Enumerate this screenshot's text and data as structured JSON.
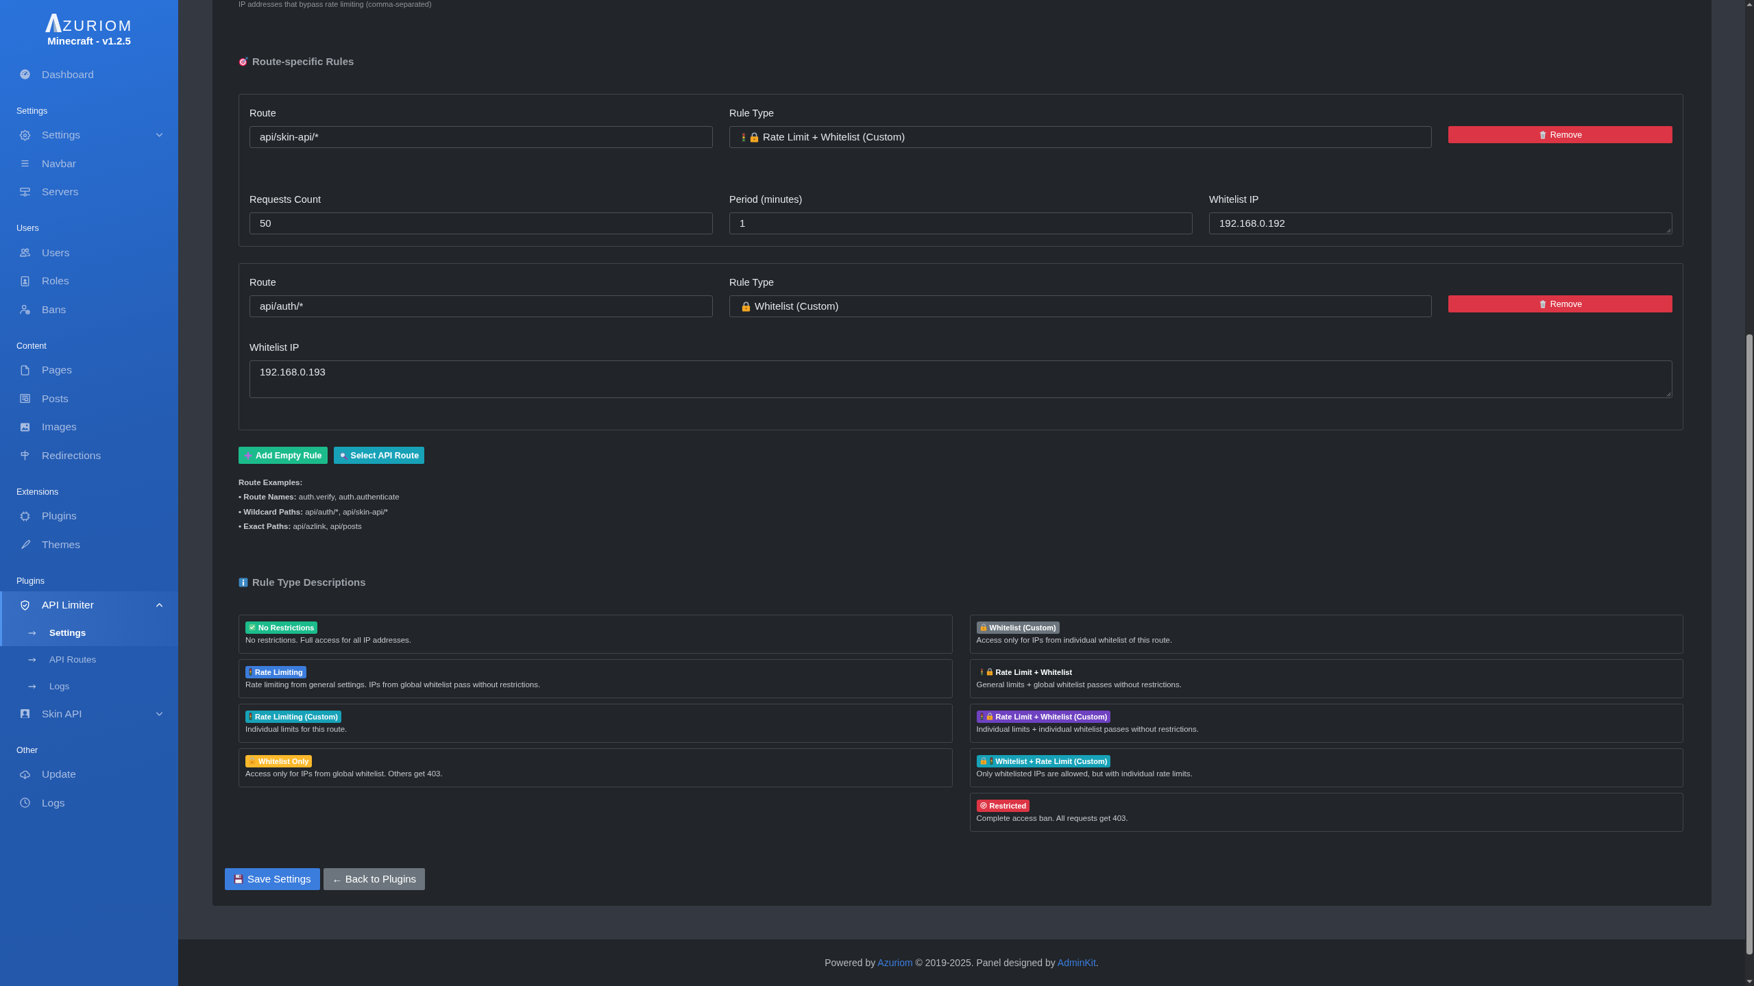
{
  "sidebar": {
    "logo_text": "ZURIOM",
    "subtitle": "Minecraft - v1.2.5",
    "sections": [
      {
        "items": [
          {
            "label": "Dashboard",
            "selected": false
          }
        ]
      },
      {
        "header": "Settings",
        "items": [
          {
            "label": "Settings",
            "selected": false,
            "expanded": false
          },
          {
            "label": "Navbar",
            "selected": false
          },
          {
            "label": "Servers",
            "selected": false
          }
        ]
      },
      {
        "header": "Users",
        "items": [
          {
            "label": "Users",
            "selected": false
          },
          {
            "label": "Roles",
            "selected": false
          },
          {
            "label": "Bans",
            "selected": false
          }
        ]
      },
      {
        "header": "Content",
        "items": [
          {
            "label": "Pages",
            "selected": false
          },
          {
            "label": "Posts",
            "selected": false
          },
          {
            "label": "Images",
            "selected": false
          },
          {
            "label": "Redirections",
            "selected": false
          }
        ]
      },
      {
        "header": "Extensions",
        "items": [
          {
            "label": "Plugins",
            "selected": false
          },
          {
            "label": "Themes",
            "selected": false
          }
        ]
      },
      {
        "header": "Plugins",
        "items": [
          {
            "label": "API Limiter",
            "selected": true,
            "expanded": true,
            "children": [
              {
                "label": "Settings",
                "selected": true
              },
              {
                "label": "API Routes",
                "selected": false
              },
              {
                "label": "Logs",
                "selected": false
              }
            ]
          },
          {
            "label": "Skin API",
            "selected": false,
            "expanded": false
          }
        ]
      },
      {
        "header": "Other",
        "items": [
          {
            "label": "Update",
            "selected": false
          },
          {
            "label": "Logs",
            "selected": false
          }
        ]
      }
    ]
  },
  "main": {
    "hint": "IP addresses that bypass rate limiting (comma-separated)",
    "route_rules": {
      "title": "Route-specific Rules",
      "rules": [
        {
          "route": {
            "label": "Route",
            "value": "api/skin-api/*"
          },
          "rule_type": {
            "label": "Rule Type",
            "value": "Rate Limit + Whitelist (Custom)",
            "kind": "ratelimitwhitelistcustom"
          },
          "remove_button": "Remove",
          "fields": [
            {
              "label": "Requests Count",
              "value": "50",
              "kind": "input"
            },
            {
              "label": "Period (minutes)",
              "value": "1",
              "kind": "input"
            },
            {
              "label": "Whitelist IP",
              "value": "192.168.0.192",
              "kind": "textarea"
            }
          ]
        },
        {
          "route": {
            "label": "Route",
            "value": "api/auth/*"
          },
          "rule_type": {
            "label": "Rule Type",
            "value": "Whitelist (Custom)",
            "kind": "whitelistcustom"
          },
          "remove_button": "Remove",
          "fields": [
            {
              "label": "Whitelist IP",
              "value": "192.168.0.193",
              "kind": "textarea"
            }
          ]
        }
      ]
    },
    "add_button": "Add Empty Rule",
    "select_button": "Select API Route",
    "examples": {
      "title": "Route Examples:",
      "lines": [
        {
          "term": "• Route Names:",
          "text": "auth.verify, auth.authenticate"
        },
        {
          "term": "• Wildcard Paths:",
          "text": "api/auth/*, api/skin-api/*"
        },
        {
          "term": "• Exact Paths:",
          "text": "api/azlink, api/posts"
        }
      ]
    },
    "descriptions": {
      "title": "Rule Type Descriptions",
      "columns": [
        {
          "items": [
            {
              "kind": "norestrictions",
              "badge": "No Restrictions",
              "color": "#1cbb8c",
              "text": "No restrictions. Full access for all IP addresses."
            },
            {
              "kind": "ratelimit",
              "badge": "Rate Limiting",
              "color": "#3b7ddd",
              "text": "Rate limiting from general settings. IPs from global whitelist pass without restrictions."
            },
            {
              "kind": "ratelimitcustom",
              "badge": "Rate Limiting (Custom)",
              "color": "#17a2b8",
              "text": "Individual limits for this route."
            },
            {
              "kind": "whitelistonly",
              "badge": "Whitelist Only",
              "color": "#fcb92c",
              "text": "Access only for IPs from global whitelist. Others get 403."
            }
          ]
        },
        {
          "items": [
            {
              "kind": "whitelistcustom",
              "badge": "Whitelist (Custom)",
              "color": "#6c757d",
              "text": "Access only for IPs from individual whitelist of this route."
            },
            {
              "kind": "ratelimitwhitelist",
              "badge": "Rate Limit + Whitelist",
              "color": "#212529",
              "text": "General limits + global whitelist passes without restrictions."
            },
            {
              "kind": "ratelimitwhitelistcustom",
              "badge": "Rate Limit + Whitelist (Custom)",
              "color": "#6f42c1",
              "text": "Individual limits + individual whitelist passes without restrictions."
            },
            {
              "kind": "whitelistratelimitcustom",
              "badge": "Whitelist + Rate Limit (Custom)",
              "color": "#17a2b8",
              "text": "Only whitelisted IPs are allowed, but with individual rate limits."
            },
            {
              "kind": "restricted",
              "badge": "Restricted",
              "color": "#dc3545",
              "text": "Complete access ban. All requests get 403."
            }
          ]
        }
      ]
    },
    "save_button": "Save Settings",
    "back_button": "← Back to Plugins"
  },
  "footer": {
    "before": "Powered by",
    "link": "Azuriom",
    "middle": "© 2019-2025. Panel designed by",
    "link_2": "AdminKit",
    "after": "."
  }
}
